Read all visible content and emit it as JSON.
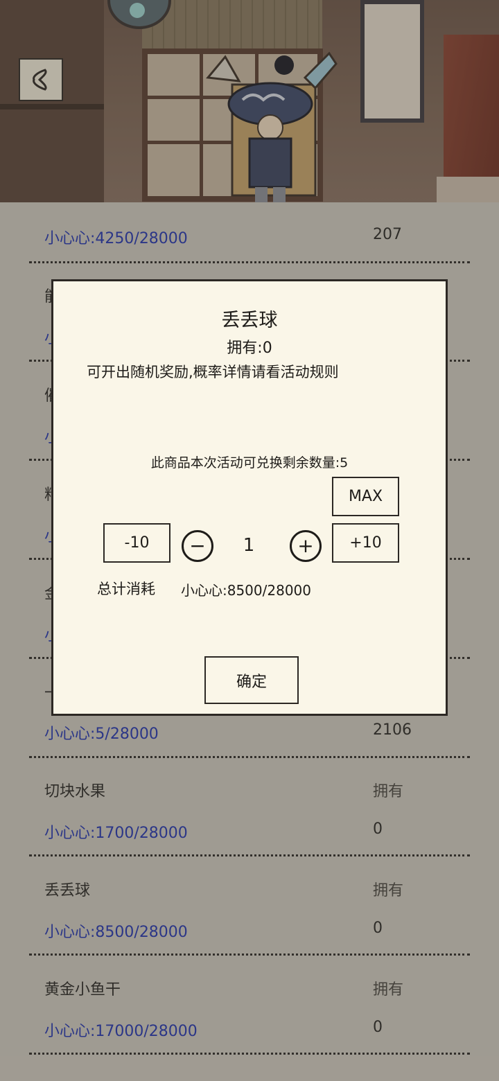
{
  "list": {
    "items": [
      {
        "cost": "小心心:4250/28000",
        "owned": "207"
      },
      {
        "name_partial": "能",
        "cost_partial": "小"
      },
      {
        "name_partial": "催",
        "cost_partial": "小"
      },
      {
        "name_partial": "料",
        "cost_partial": "小"
      },
      {
        "name_partial": "金",
        "cost_partial": "小"
      },
      {
        "name_partial": "一",
        "cost": "小心心:5/28000",
        "owned": "2106"
      },
      {
        "name": "切块水果",
        "owned_label": "拥有",
        "cost": "小心心:1700/28000",
        "owned": "0"
      },
      {
        "name": "丢丢球",
        "owned_label": "拥有",
        "cost": "小心心:8500/28000",
        "owned": "0"
      },
      {
        "name": "黄金小鱼干",
        "owned_label": "拥有",
        "cost": "小心心:17000/28000",
        "owned": "0"
      }
    ]
  },
  "dialog": {
    "title": "丢丢球",
    "owned": "拥有:0",
    "description": "可开出随机奖励,概率详情请看活动规则",
    "remaining": "此商品本次活动可兑换剩余数量:5",
    "max_label": "MAX",
    "minus10_label": "-10",
    "minus_symbol": "−",
    "quantity": "1",
    "plus_symbol": "+",
    "plus10_label": "+10",
    "total_label": "总计消耗",
    "total_value": "小心心:8500/28000",
    "confirm_label": "确定"
  },
  "colors": {
    "cost_text": "#2436b0",
    "dialog_bg": "#faf6e8",
    "list_bg": "#cfcbc0"
  }
}
